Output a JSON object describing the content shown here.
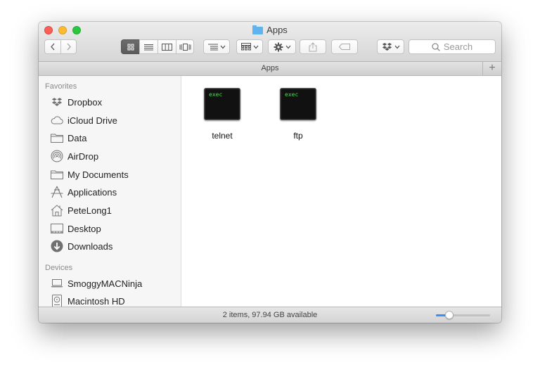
{
  "window": {
    "title": "Apps"
  },
  "toolbar": {
    "search_placeholder": "Search"
  },
  "pathbar": {
    "label": "Apps",
    "plus": "+"
  },
  "sidebar": {
    "favorites_title": "Favorites",
    "favorites": [
      {
        "label": "Dropbox",
        "icon": "dropbox-icon"
      },
      {
        "label": "iCloud Drive",
        "icon": "cloud-icon"
      },
      {
        "label": "Data",
        "icon": "folder-icon"
      },
      {
        "label": "AirDrop",
        "icon": "airdrop-icon"
      },
      {
        "label": "My Documents",
        "icon": "folder-icon"
      },
      {
        "label": "Applications",
        "icon": "applications-icon"
      },
      {
        "label": "PeteLong1",
        "icon": "home-icon"
      },
      {
        "label": "Desktop",
        "icon": "desktop-icon"
      },
      {
        "label": "Downloads",
        "icon": "downloads-icon"
      }
    ],
    "devices_title": "Devices",
    "devices": [
      {
        "label": "SmoggyMACNinja",
        "icon": "laptop-icon"
      },
      {
        "label": "Macintosh HD",
        "icon": "harddisk-icon"
      }
    ]
  },
  "files": [
    {
      "name": "telnet",
      "icon_text": "exec"
    },
    {
      "name": "ftp",
      "icon_text": "exec"
    }
  ],
  "status": {
    "text": "2 items, 97.94 GB available",
    "icon_size_fraction": 0.25
  },
  "colors": {
    "accent": "#3b8ef5",
    "folder": "#5fb3ef",
    "exec_text": "#54d35a"
  }
}
